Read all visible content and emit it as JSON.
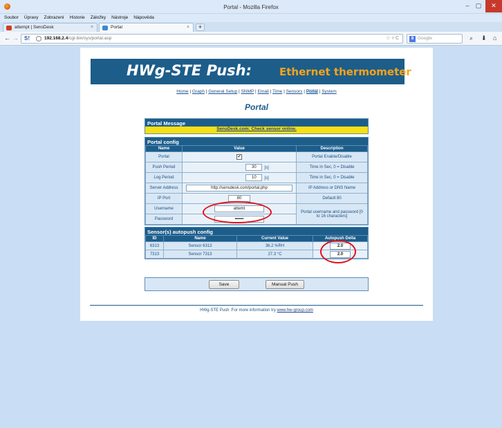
{
  "window": {
    "title": "Portal - Mozilla Firefox",
    "min": "–",
    "max": "▢",
    "close": "✕"
  },
  "menubar": [
    "Soubor",
    "Úpravy",
    "Zobrazení",
    "Historie",
    "Záložky",
    "Nástroje",
    "Nápověda"
  ],
  "tabs": [
    {
      "label": "attempt | SensDesk",
      "close": "×"
    },
    {
      "label": "Portal",
      "close": "×"
    }
  ],
  "newtab": "+",
  "nav": {
    "back": "←",
    "forward": "→",
    "site_icon": "S!",
    "url_host": "192.168.2.4",
    "url_path": "/cgi-bin/sys/portal.asp",
    "url_tools": "☆ ▿ C",
    "search_engine": "8",
    "search_placeholder": "Google",
    "search_icon": "⌕",
    "download_icon": "⬇",
    "home_icon": "⌂"
  },
  "banner": {
    "product": "HWg-STE Push:",
    "subtitle": "Ethernet thermometer"
  },
  "menu": {
    "items": [
      "Home",
      "Graph",
      "General Setup",
      "SNMP",
      "Email",
      "Time",
      "Sensors",
      "Portal",
      "System"
    ],
    "separator": "|"
  },
  "page_title": "Portal",
  "portal_message": {
    "header": "Portal Message",
    "text": "SensDesk.com: Check sensor online."
  },
  "portal_config": {
    "header": "Portal config",
    "columns": [
      "Name",
      "Value",
      "Description"
    ],
    "rows": {
      "portal": {
        "name": "Portal",
        "checked": "✔",
        "desc": "Portal Enable/Disable"
      },
      "push": {
        "name": "Push Period",
        "value": "30",
        "unit": "[s]",
        "desc": "Time in Sec, 0 = Disable"
      },
      "log": {
        "name": "Log Period",
        "value": "10",
        "unit": "[s]",
        "desc": "Time in Sec, 0 = Disable"
      },
      "server": {
        "name": "Server Address",
        "value": "http://sensdesk.com/portal.php",
        "desc": "IP Address or DNS Name"
      },
      "port": {
        "name": "IP Port",
        "value": "80",
        "desc": "Default 80"
      },
      "username": {
        "name": "Username",
        "value": "attemt"
      },
      "password": {
        "name": "Password",
        "value": "••••••"
      },
      "cred_desc": "Portal username and password [0 to 16 characters]"
    }
  },
  "sensors": {
    "header": "Sensor(s) autopush config",
    "columns": [
      "ID",
      "Name",
      "Current Value",
      "Autopush Delta"
    ],
    "rows": [
      {
        "id": "6313",
        "name": "Sensor 6313",
        "value": "36.2 %RH",
        "delta": "2.0"
      },
      {
        "id": "7313",
        "name": "Sensor 7313",
        "value": "27.3 °C",
        "delta": "2.0"
      }
    ]
  },
  "buttons": {
    "save": "Save",
    "manual_push": "Manual Push"
  },
  "footer": {
    "text": "HWg-STE Push :For more information try ",
    "link": "www.hw-group.com"
  }
}
